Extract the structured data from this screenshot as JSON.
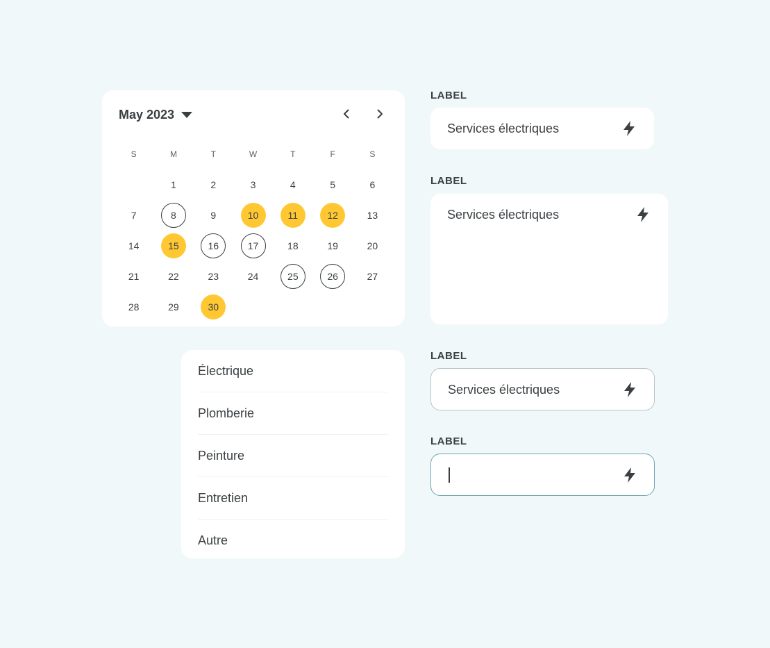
{
  "calendar": {
    "month_label": "May 2023",
    "weekdays": [
      "S",
      "M",
      "T",
      "W",
      "T",
      "F",
      "S"
    ],
    "weeks": [
      [
        {
          "d": ""
        },
        {
          "d": "1"
        },
        {
          "d": "2"
        },
        {
          "d": "3"
        },
        {
          "d": "4"
        },
        {
          "d": "5"
        },
        {
          "d": "6"
        }
      ],
      [
        {
          "d": "7"
        },
        {
          "d": "8",
          "s": "outlined"
        },
        {
          "d": "9"
        },
        {
          "d": "10",
          "s": "selected"
        },
        {
          "d": "11",
          "s": "selected"
        },
        {
          "d": "12",
          "s": "selected"
        },
        {
          "d": "13"
        }
      ],
      [
        {
          "d": "14"
        },
        {
          "d": "15",
          "s": "selected"
        },
        {
          "d": "16",
          "s": "outlined"
        },
        {
          "d": "17",
          "s": "outlined"
        },
        {
          "d": "18"
        },
        {
          "d": "19"
        },
        {
          "d": "20"
        }
      ],
      [
        {
          "d": "21"
        },
        {
          "d": "22"
        },
        {
          "d": "23"
        },
        {
          "d": "24"
        },
        {
          "d": "25",
          "s": "outlined"
        },
        {
          "d": "26",
          "s": "outlined"
        },
        {
          "d": "27"
        }
      ],
      [
        {
          "d": "28"
        },
        {
          "d": "29"
        },
        {
          "d": "30",
          "s": "selected"
        },
        {
          "d": ""
        },
        {
          "d": ""
        },
        {
          "d": ""
        },
        {
          "d": ""
        }
      ]
    ],
    "icons": {
      "dropdown": "caret-down-icon",
      "prev": "chevron-left-icon",
      "next": "chevron-right-icon"
    }
  },
  "options_list": {
    "items": [
      "Électrique",
      "Plomberie",
      "Peinture",
      "Entretien",
      "Autre"
    ]
  },
  "fields": [
    {
      "label": "LABEL",
      "value": "Services électriques",
      "icon": "lightning-icon",
      "state": "default"
    },
    {
      "label": "LABEL",
      "value": "Services électriques",
      "icon": "lightning-icon",
      "state": "textarea"
    },
    {
      "label": "LABEL",
      "value": "Services électriques",
      "icon": "lightning-icon",
      "state": "outlined"
    },
    {
      "label": "LABEL",
      "value": "",
      "icon": "lightning-icon",
      "state": "focused"
    }
  ],
  "colors": {
    "background": "#f1f8fa",
    "accent_yellow": "#ffc833",
    "text": "#3a3f42",
    "focus_border": "#6ea3b3"
  }
}
